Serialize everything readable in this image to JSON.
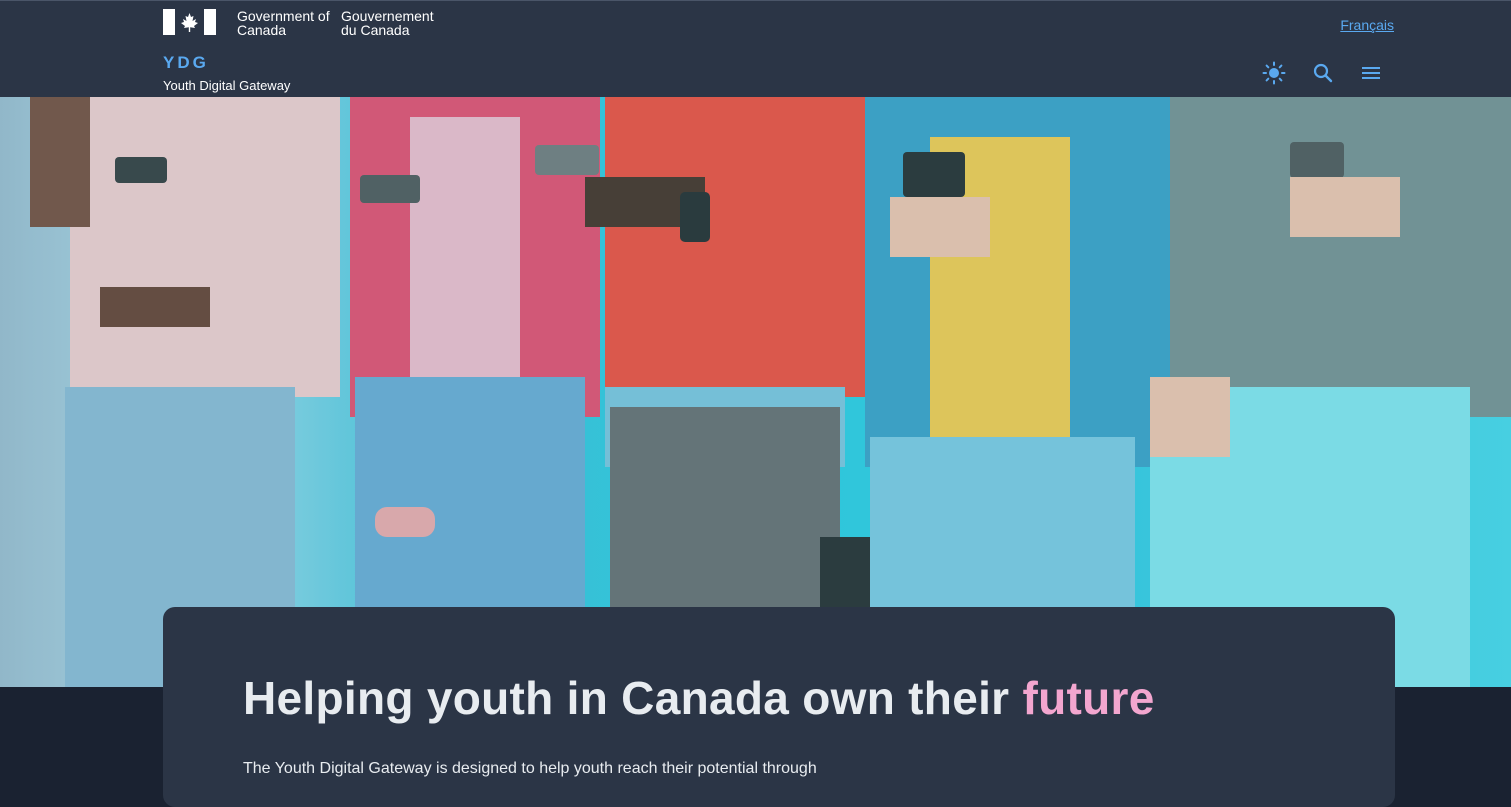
{
  "header": {
    "government_en": "Government of Canada",
    "government_fr": "Gouvernement du Canada",
    "language_link": "Français",
    "site_acronym": "YDG",
    "site_name": "Youth Digital Gateway",
    "icons": [
      "theme-toggle-icon",
      "search-icon",
      "menu-icon"
    ]
  },
  "hero": {
    "image": "group-of-youth-using-smartphones"
  },
  "card": {
    "headline_main": "Helping youth in Canada own their",
    "headline_highlight": "future",
    "intro": "The Youth Digital Gateway is designed to help youth reach their potential through"
  },
  "colors": {
    "header_bg": "#2b3546",
    "page_bg": "#1a2231",
    "accent_blue": "#5aa9f0",
    "highlight_pink": "#f3a6cf"
  }
}
